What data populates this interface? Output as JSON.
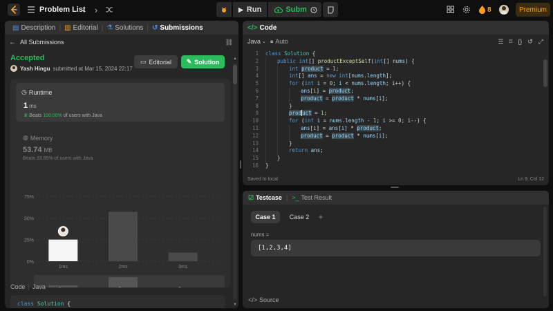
{
  "topbar": {
    "problem_list": "Problem List",
    "run": "Run",
    "submit": "Submit",
    "streak": "8",
    "premium": "Premium"
  },
  "left": {
    "tabs": [
      "Description",
      "Editorial",
      "Solutions",
      "Submissions"
    ],
    "back": "All Submissions",
    "status": "Accepted",
    "user": "Yash Hingu",
    "submitted": "submitted at Mar 15, 2024 22:17",
    "editorial_btn": "Editorial",
    "solution_btn": "Solution",
    "runtime": {
      "title": "Runtime",
      "value": "1",
      "unit": "ms",
      "beats_prefix": "Beats",
      "beats_pct": "100.00%",
      "beats_suffix": "of users with Java"
    },
    "memory": {
      "title": "Memory",
      "value": "53.74",
      "unit": "MB",
      "beats_text": "Beats 33.85% of users with Java"
    },
    "code_label": "Code",
    "code_lang": "Java",
    "code_preview": "class Solution {"
  },
  "chart_data": {
    "type": "bar",
    "categories": [
      "1ms",
      "2ms",
      "3ms"
    ],
    "values": [
      25,
      57,
      10
    ],
    "yticks": [
      "0%",
      "25%",
      "50%",
      "75%"
    ],
    "ylim": [
      0,
      75
    ],
    "highlight": "1ms",
    "overview_categories": [
      "1ms",
      "2ms",
      "3ms"
    ],
    "overview_values": [
      25,
      57,
      10
    ],
    "colors": {
      "highlight": "#f5f5f5",
      "bar": "#4a4a4a",
      "grid": "#3d3d3d"
    }
  },
  "code": {
    "title": "Code",
    "lang": "Java",
    "mode": "Auto",
    "saved": "Saved to local",
    "cursor": "Ln 9, Col 12",
    "line_numbers": [
      "1",
      "2",
      "3",
      "4",
      "5",
      "6",
      "7",
      "8",
      "9",
      "10",
      "11",
      "12",
      "13",
      "14",
      "15",
      "16"
    ]
  },
  "test": {
    "tab_testcase": "Testcase",
    "tab_result": "Test Result",
    "case1": "Case 1",
    "case2": "Case 2",
    "plus": "+",
    "nums_label": "nums =",
    "nums_value": "[1,2,3,4]",
    "source": "Source"
  }
}
